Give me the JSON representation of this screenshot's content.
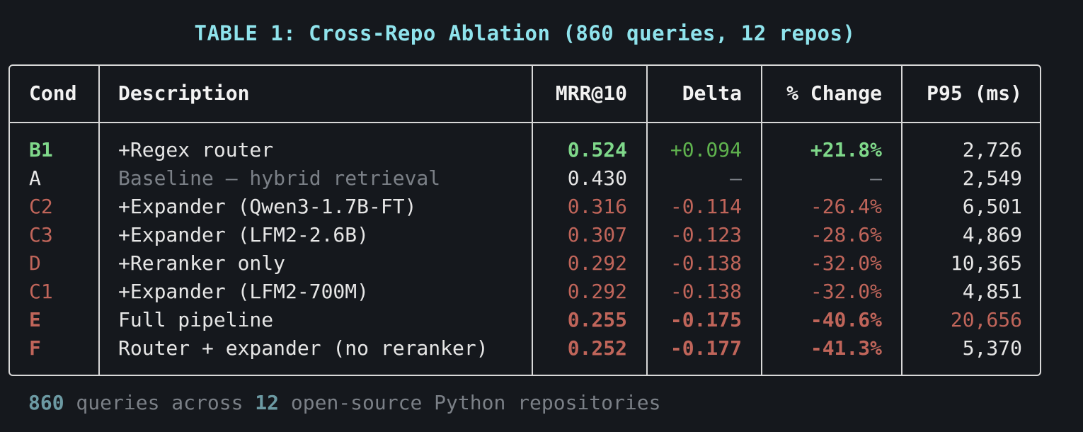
{
  "title": "TABLE 1: Cross-Repo Ablation (860 queries, 12 repos)",
  "colors": {
    "background": "#15181d",
    "title": "#8fe3ec",
    "border": "#d8d8d8",
    "positive": "#7fd88a",
    "positive_delta": "#5fb24e",
    "negative": "#c0655a",
    "neutral": "#e6e6e6",
    "muted": "#7b8087",
    "footer_number": "#6c9aa3"
  },
  "table": {
    "headers": {
      "cond": "Cond",
      "description": "Description",
      "mrr": "MRR@10",
      "delta": "Delta",
      "change": "% Change",
      "p95": "P95 (ms)"
    },
    "rows": [
      {
        "cond": "B1",
        "description": "+Regex router",
        "mrr": "0.524",
        "delta": "+0.094",
        "change": "+21.8%",
        "p95": "2,726",
        "tone": "positive"
      },
      {
        "cond": "A",
        "description": "Baseline — hybrid retrieval",
        "mrr": "0.430",
        "delta": "—",
        "change": "—",
        "p95": "2,549",
        "tone": "baseline"
      },
      {
        "cond": "C2",
        "description": "+Expander (Qwen3-1.7B-FT)",
        "mrr": "0.316",
        "delta": "-0.114",
        "change": "-26.4%",
        "p95": "6,501",
        "tone": "negative"
      },
      {
        "cond": "C3",
        "description": "+Expander (LFM2-2.6B)",
        "mrr": "0.307",
        "delta": "-0.123",
        "change": "-28.6%",
        "p95": "4,869",
        "tone": "negative"
      },
      {
        "cond": "D",
        "description": "+Reranker only",
        "mrr": "0.292",
        "delta": "-0.138",
        "change": "-32.0%",
        "p95": "10,365",
        "tone": "negative"
      },
      {
        "cond": "C1",
        "description": "+Expander (LFM2-700M)",
        "mrr": "0.292",
        "delta": "-0.138",
        "change": "-32.0%",
        "p95": "4,851",
        "tone": "negative"
      },
      {
        "cond": "E",
        "description": "Full pipeline",
        "mrr": "0.255",
        "delta": "-0.175",
        "change": "-40.6%",
        "p95": "20,656",
        "tone": "strong-negative",
        "p95_highlight": true
      },
      {
        "cond": "F",
        "description": "Router + expander (no reranker)",
        "mrr": "0.252",
        "delta": "-0.177",
        "change": "-41.3%",
        "p95": "5,370",
        "tone": "strong-negative"
      }
    ]
  },
  "footer": {
    "queries_count": "860",
    "text_1": " queries across ",
    "repos_count": "12",
    "text_2": " open-source Python repositories"
  }
}
